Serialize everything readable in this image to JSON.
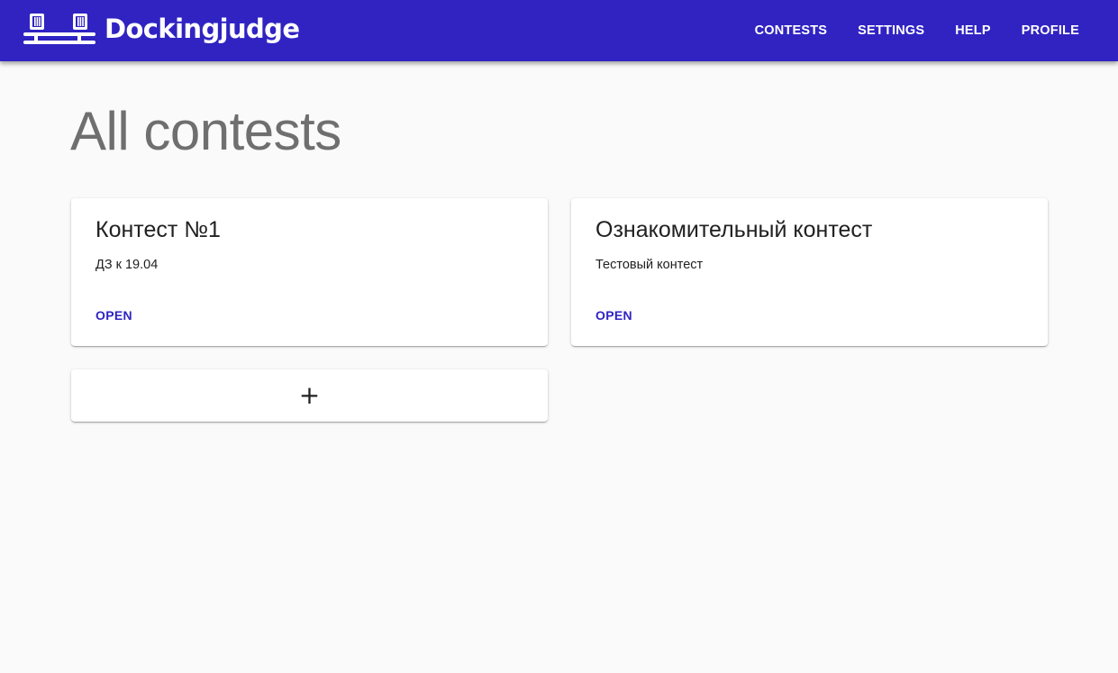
{
  "header": {
    "brand_name": "Dockingjudge",
    "logo_icon": "server-pair-logo-icon",
    "nav": [
      {
        "label": "CONTESTS"
      },
      {
        "label": "SETTINGS"
      },
      {
        "label": "HELP"
      },
      {
        "label": "PROFILE"
      }
    ],
    "colors": {
      "appbar": "#3023c2",
      "text": "#ffffff"
    }
  },
  "main": {
    "title": "All contests",
    "contests": [
      {
        "title": "Контест №1",
        "description": "ДЗ к 19.04",
        "action_label": "OPEN"
      },
      {
        "title": "Ознакомительный контест",
        "description": "Тестовый контест",
        "action_label": "OPEN"
      }
    ],
    "add_card": {
      "icon": "plus-icon",
      "glyph": "+"
    }
  },
  "colors": {
    "accent": "#3023c2",
    "background": "#fafafa",
    "title_gray": "#6f6f6f"
  }
}
